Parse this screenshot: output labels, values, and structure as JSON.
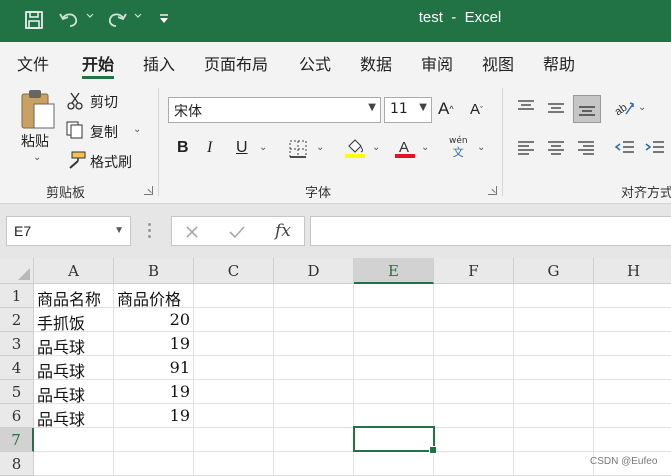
{
  "window": {
    "title": "test  -  Excel"
  },
  "quick_access": {
    "icons": [
      "save-icon",
      "undo-icon",
      "redo-icon",
      "customize-icon"
    ]
  },
  "menu": {
    "tabs": [
      {
        "label": "文件"
      },
      {
        "label": "开始",
        "active": true
      },
      {
        "label": "插入"
      },
      {
        "label": "页面布局"
      },
      {
        "label": "公式"
      },
      {
        "label": "数据"
      },
      {
        "label": "审阅"
      },
      {
        "label": "视图"
      },
      {
        "label": "帮助"
      }
    ]
  },
  "ribbon": {
    "clipboard": {
      "group_label": "剪贴板",
      "paste_label": "粘贴",
      "cut_label": "剪切",
      "copy_label": "复制",
      "format_painter_label": "格式刷"
    },
    "font": {
      "group_label": "字体",
      "font_name": "宋体",
      "font_size": "11",
      "bold": "B",
      "italic": "I",
      "underline": "U",
      "phonetic_top": "wén",
      "phonetic_bottom": "文",
      "fill_color": "#ffff00",
      "font_color": "#e81123"
    },
    "alignment": {
      "group_label": "对齐方式"
    }
  },
  "formula_bar": {
    "name_box": "E7",
    "fx_label": "fx",
    "formula": ""
  },
  "sheet": {
    "columns": [
      "A",
      "B",
      "C",
      "D",
      "E",
      "F",
      "G",
      "H"
    ],
    "rows": [
      "1",
      "2",
      "3",
      "4",
      "5",
      "6",
      "7",
      "8"
    ],
    "selected_column": "E",
    "selected_row": "7",
    "data": [
      [
        "商品名称",
        "商品价格"
      ],
      [
        "手抓饭",
        "20"
      ],
      [
        "品乓球",
        "19"
      ],
      [
        "品乓球",
        "91"
      ],
      [
        "品乓球",
        "19"
      ],
      [
        "品乓球",
        "19"
      ]
    ]
  },
  "watermark": "CSDN @Eufeo",
  "colors": {
    "accent": "#217346",
    "ribbon_bg": "#f3f3f3",
    "grid_line": "#e1e1e1"
  }
}
